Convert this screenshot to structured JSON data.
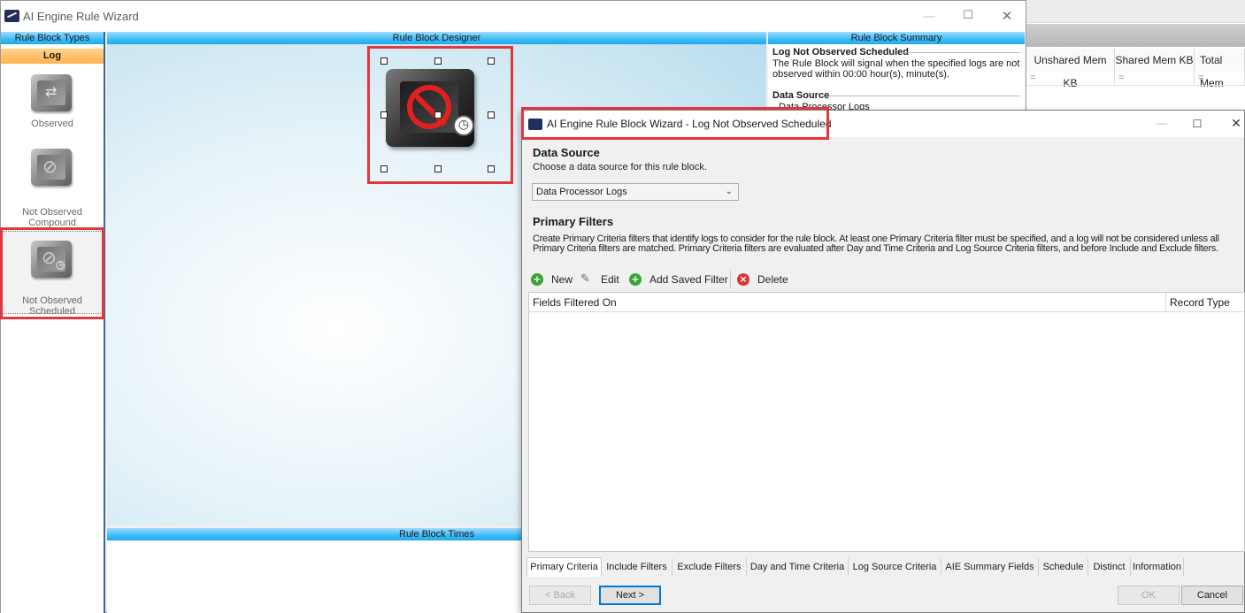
{
  "main_window": {
    "title": "AI Engine Rule Wizard",
    "controls": {
      "minimize": "—",
      "maximize": "☐",
      "close": "✕"
    }
  },
  "rule_block_types": {
    "header": "Rule Block Types",
    "category_tab": "Log",
    "items": [
      {
        "label": "Observed",
        "icon": "observed-cube-icon"
      },
      {
        "label": "Not Observed Compound",
        "icon": "not-observed-compound-cube-icon"
      },
      {
        "label": "Not Observed Scheduled",
        "icon": "not-observed-scheduled-cube-icon",
        "selected": true
      }
    ]
  },
  "designer": {
    "header": "Rule Block Designer",
    "icon": "not-observed-scheduled-cube-icon"
  },
  "times": {
    "header": "Rule Block Times"
  },
  "summary": {
    "header": "Rule Block Summary",
    "title": "Log Not Observed Scheduled",
    "description": "The Rule Block will signal when the specified logs are not observed within 00:00 hour(s), minute(s).",
    "data_source_label": "Data Source",
    "data_source_value": "Data Processor Logs"
  },
  "background_grid": {
    "columns": [
      "Unshared Mem KB",
      "Shared Mem KB",
      "Total Mem"
    ],
    "filter_symbol": "="
  },
  "dialog": {
    "title": "AI Engine Rule Block Wizard - Log Not Observed Scheduled",
    "controls": {
      "minimize": "—",
      "maximize": "☐",
      "close": "✕"
    },
    "data_source": {
      "title": "Data Source",
      "subtitle": "Choose a data source for this rule block.",
      "selected": "Data Processor Logs"
    },
    "primary_filters": {
      "title": "Primary Filters",
      "description": "Create Primary Criteria filters that identify logs to consider for the rule block. At least one Primary Criteria filter must be specified, and a log will not be considered unless all Primary Criteria filters are matched. Primary Criteria filters are evaluated after Day and Time Criteria and Log Source Criteria filters, and before Include and Exclude filters."
    },
    "toolbar": {
      "new": "New",
      "edit": "Edit",
      "add_saved": "Add Saved Filter",
      "delete": "Delete"
    },
    "grid_columns": [
      "Fields Filtered On",
      "Record Type"
    ],
    "tabs": [
      "Primary Criteria",
      "Include Filters",
      "Exclude Filters",
      "Day and Time Criteria",
      "Log Source Criteria",
      "AIE Summary Fields",
      "Schedule",
      "Distinct",
      "Information"
    ],
    "active_tab": "Primary Criteria",
    "buttons": {
      "back": "< Back",
      "next": "Next >",
      "ok": "OK",
      "cancel": "Cancel"
    }
  },
  "colors": {
    "header_blue": "#3bbcf7",
    "log_tab_orange": "#ffb24e",
    "highlight_red": "#e0383e",
    "accent_blue": "#0078d7"
  }
}
